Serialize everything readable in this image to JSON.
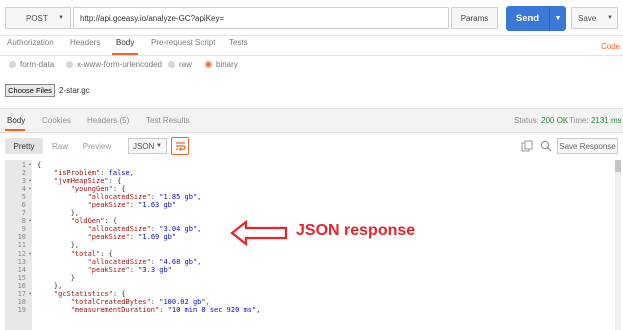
{
  "request": {
    "method": "POST",
    "url": "http://api.gceasy.io/analyze-GC?apiKey=",
    "params_label": "Params",
    "send_label": "Send",
    "save_label": "Save"
  },
  "request_tabs": [
    "Authorization",
    "Headers",
    "Body",
    "Pre-request Script",
    "Tests"
  ],
  "active_request_tab": "Body",
  "code_link": "Code",
  "body_types": [
    "form-data",
    "x-www-form-urlencoded",
    "raw",
    "binary"
  ],
  "selected_body_type": "binary",
  "file": {
    "button": "Choose Files",
    "name": "2-star.gc"
  },
  "response_tabs": [
    "Body",
    "Cookies",
    "Headers (5)",
    "Test Results"
  ],
  "active_response_tab": "Body",
  "status": {
    "status_label": "Status:",
    "status_value": "200 OK",
    "time_label": "Time:",
    "time_value": "2131 ms"
  },
  "viewer": {
    "pretty": "Pretty",
    "raw": "Raw",
    "preview": "Preview",
    "format": "JSON",
    "save_response": "Save Response"
  },
  "code_lines": [
    {
      "n": "1",
      "fold": true,
      "parts": [
        [
          "p",
          "{"
        ]
      ]
    },
    {
      "n": "2",
      "fold": false,
      "parts": [
        [
          "p",
          "    "
        ],
        [
          "k",
          "\"isProblem\""
        ],
        [
          "p",
          ": "
        ],
        [
          "b",
          "false"
        ],
        [
          "p",
          ","
        ]
      ]
    },
    {
      "n": "3",
      "fold": true,
      "parts": [
        [
          "p",
          "    "
        ],
        [
          "k",
          "\"jvmHeapSize\""
        ],
        [
          "p",
          ": {"
        ]
      ]
    },
    {
      "n": "4",
      "fold": true,
      "parts": [
        [
          "p",
          "        "
        ],
        [
          "k",
          "\"youngGen\""
        ],
        [
          "p",
          ": {"
        ]
      ]
    },
    {
      "n": "5",
      "fold": false,
      "parts": [
        [
          "p",
          "            "
        ],
        [
          "k",
          "\"allocatedSize\""
        ],
        [
          "p",
          ": "
        ],
        [
          "s",
          "\"1.85 gb\""
        ],
        [
          "p",
          ","
        ]
      ]
    },
    {
      "n": "6",
      "fold": false,
      "parts": [
        [
          "p",
          "            "
        ],
        [
          "k",
          "\"peakSize\""
        ],
        [
          "p",
          ": "
        ],
        [
          "s",
          "\"1.63 gb\""
        ]
      ]
    },
    {
      "n": "7",
      "fold": false,
      "parts": [
        [
          "p",
          "        },"
        ]
      ]
    },
    {
      "n": "8",
      "fold": true,
      "parts": [
        [
          "p",
          "        "
        ],
        [
          "k",
          "\"oldGen\""
        ],
        [
          "p",
          ": {"
        ]
      ]
    },
    {
      "n": "9",
      "fold": false,
      "parts": [
        [
          "p",
          "            "
        ],
        [
          "k",
          "\"allocatedSize\""
        ],
        [
          "p",
          ": "
        ],
        [
          "s",
          "\"3.04 gb\""
        ],
        [
          "p",
          ","
        ]
      ]
    },
    {
      "n": "10",
      "fold": false,
      "parts": [
        [
          "p",
          "            "
        ],
        [
          "k",
          "\"peakSize\""
        ],
        [
          "p",
          ": "
        ],
        [
          "s",
          "\"1.69 gb\""
        ]
      ]
    },
    {
      "n": "11",
      "fold": false,
      "parts": [
        [
          "p",
          "        },"
        ]
      ]
    },
    {
      "n": "12",
      "fold": true,
      "parts": [
        [
          "p",
          "        "
        ],
        [
          "k",
          "\"total\""
        ],
        [
          "p",
          ": {"
        ]
      ]
    },
    {
      "n": "13",
      "fold": false,
      "parts": [
        [
          "p",
          "            "
        ],
        [
          "k",
          "\"allocatedSize\""
        ],
        [
          "p",
          ": "
        ],
        [
          "s",
          "\"4.68 gb\""
        ],
        [
          "p",
          ","
        ]
      ]
    },
    {
      "n": "14",
      "fold": false,
      "parts": [
        [
          "p",
          "            "
        ],
        [
          "k",
          "\"peakSize\""
        ],
        [
          "p",
          ": "
        ],
        [
          "s",
          "\"3.3 gb\""
        ]
      ]
    },
    {
      "n": "15",
      "fold": false,
      "parts": [
        [
          "p",
          "        }"
        ]
      ]
    },
    {
      "n": "16",
      "fold": false,
      "parts": [
        [
          "p",
          "    },"
        ]
      ]
    },
    {
      "n": "17",
      "fold": true,
      "parts": [
        [
          "p",
          "    "
        ],
        [
          "k",
          "\"gcStatistics\""
        ],
        [
          "p",
          ": {"
        ]
      ]
    },
    {
      "n": "18",
      "fold": false,
      "parts": [
        [
          "p",
          "        "
        ],
        [
          "k",
          "\"totalCreatedBytes\""
        ],
        [
          "p",
          ": "
        ],
        [
          "s",
          "\"100.02 gb\""
        ],
        [
          "p",
          ","
        ]
      ]
    },
    {
      "n": "19",
      "fold": false,
      "parts": [
        [
          "p",
          "        "
        ],
        [
          "k",
          "\"measurementDuration\""
        ],
        [
          "p",
          ": "
        ],
        [
          "s",
          "\"10 min 8 sec 920 ms\""
        ],
        [
          "p",
          ","
        ]
      ]
    }
  ],
  "annotation": "JSON response",
  "colors": {
    "accent": "#f06426",
    "send": "#3c78d8",
    "annotation": "#e8242a",
    "status_ok": "#2b8a3e"
  }
}
